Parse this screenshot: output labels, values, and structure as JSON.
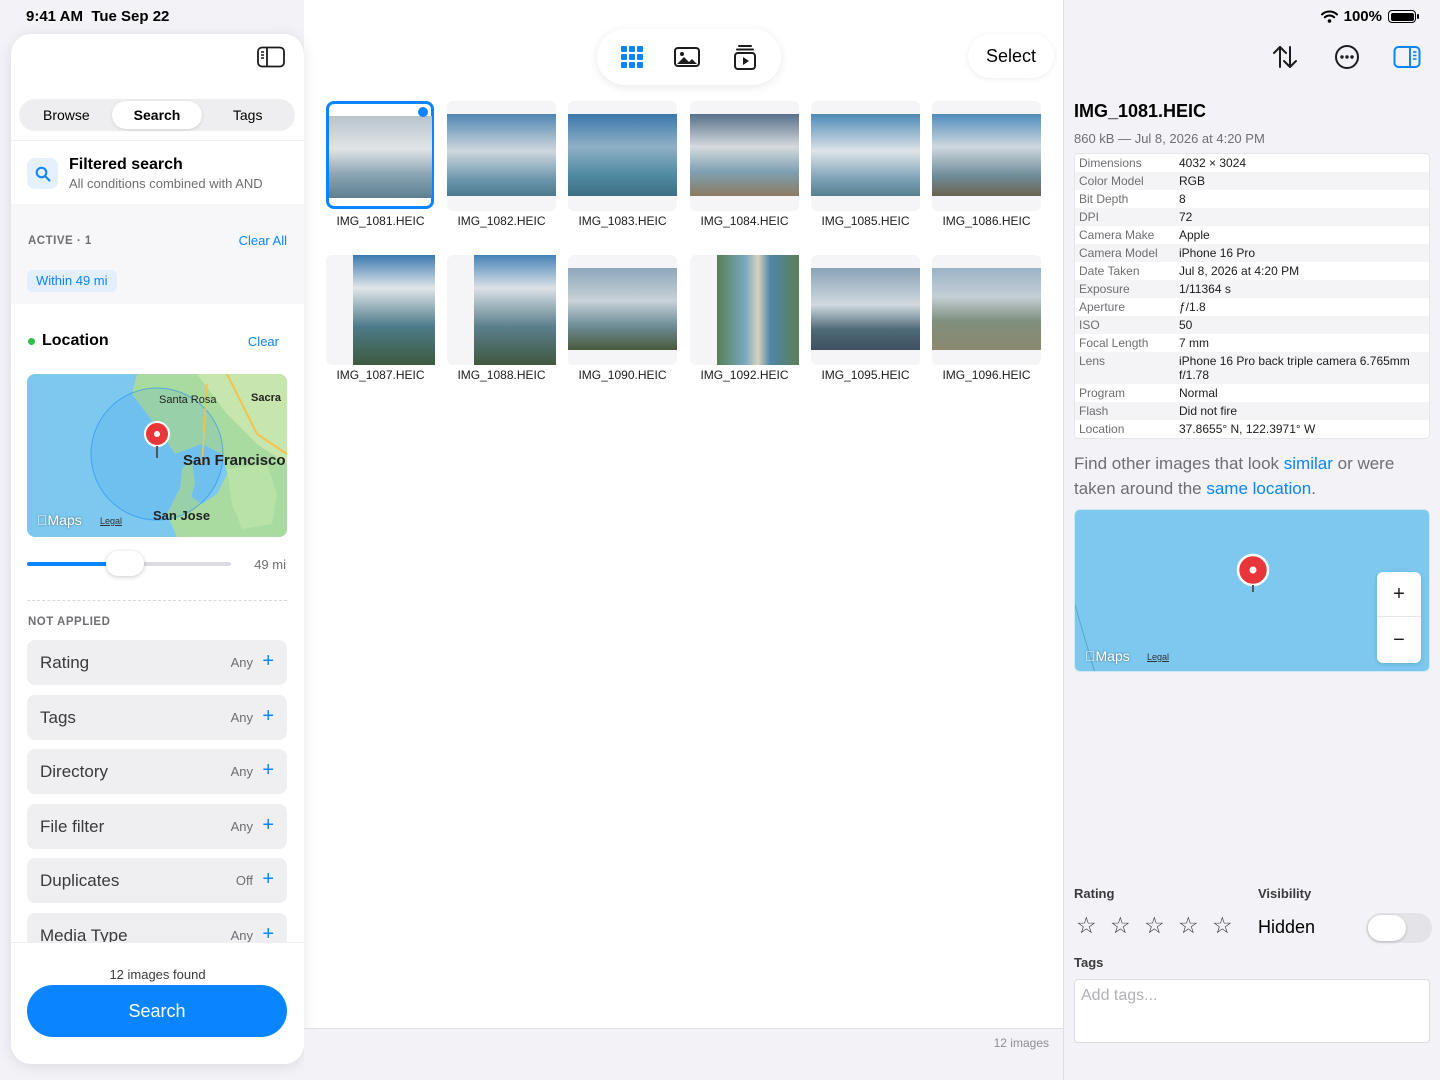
{
  "status": {
    "time": "9:41 AM",
    "date": "Tue Sep 22",
    "battery": "100%"
  },
  "sidebar": {
    "tabs": [
      {
        "label": "Browse",
        "active": false
      },
      {
        "label": "Search",
        "active": true
      },
      {
        "label": "Tags",
        "active": false
      }
    ],
    "filtered_search": {
      "title": "Filtered search",
      "subtitle": "All conditions combined with AND"
    },
    "active": {
      "label": "ACTIVE · 1",
      "clear_all": "Clear All",
      "chip": "Within 49 mi"
    },
    "location": {
      "title": "Location",
      "clear": "Clear",
      "map_labels": {
        "santa_rosa": "Santa Rosa",
        "sacramento": "Sacra",
        "san_francisco": "San Francisco",
        "san_jose": "San Jose",
        "maps": "Maps",
        "legal": "Legal"
      },
      "radius_label": "49 mi",
      "radius_fraction": 0.48
    },
    "not_applied_label": "NOT APPLIED",
    "filters": [
      {
        "name": "Rating",
        "value": "Any"
      },
      {
        "name": "Tags",
        "value": "Any"
      },
      {
        "name": "Directory",
        "value": "Any"
      },
      {
        "name": "File filter",
        "value": "Any"
      },
      {
        "name": "Duplicates",
        "value": "Off"
      },
      {
        "name": "Media Type",
        "value": "Any"
      }
    ],
    "found": "12 images found",
    "search_button": "Search"
  },
  "toolbar": {
    "select": "Select"
  },
  "images": [
    "IMG_1081.HEIC",
    "IMG_1082.HEIC",
    "IMG_1083.HEIC",
    "IMG_1084.HEIC",
    "IMG_1085.HEIC",
    "IMG_1086.HEIC",
    "IMG_1087.HEIC",
    "IMG_1088.HEIC",
    "IMG_1090.HEIC",
    "IMG_1092.HEIC",
    "IMG_1095.HEIC",
    "IMG_1096.HEIC"
  ],
  "image_count": "12 images",
  "inspector": {
    "title": "IMG_1081.HEIC",
    "subtitle": "860 kB — Jul 8, 2026 at 4:20 PM",
    "metadata": [
      {
        "k": "Dimensions",
        "v": "4032 × 3024"
      },
      {
        "k": "Color Model",
        "v": "RGB"
      },
      {
        "k": "Bit Depth",
        "v": "8"
      },
      {
        "k": "DPI",
        "v": "72"
      },
      {
        "k": "Camera Make",
        "v": "Apple"
      },
      {
        "k": "Camera Model",
        "v": "iPhone 16 Pro"
      },
      {
        "k": "Date Taken",
        "v": "Jul 8, 2026 at 4:20 PM"
      },
      {
        "k": "Exposure",
        "v": "1/11364 s"
      },
      {
        "k": "Aperture",
        "v": "ƒ/1.8"
      },
      {
        "k": "ISO",
        "v": "50"
      },
      {
        "k": "Focal Length",
        "v": "7 mm"
      },
      {
        "k": "Lens",
        "v": "iPhone 16 Pro back triple camera 6.765mm f/1.78"
      },
      {
        "k": "Program",
        "v": "Normal"
      },
      {
        "k": "Flash",
        "v": "Did not fire"
      },
      {
        "k": "Location",
        "v": "37.8655° N, 122.3971° W"
      }
    ],
    "find": {
      "prefix": "Find other images that look ",
      "similar": "similar",
      "middle": " or were taken around the ",
      "same_location": "same location",
      "suffix": "."
    },
    "map": {
      "maps": "Maps",
      "legal": "Legal",
      "zoom_in": "+",
      "zoom_out": "−"
    },
    "rating_label": "Rating",
    "visibility_label": "Visibility",
    "visibility_value": "Hidden",
    "rating_value": 0,
    "tags_label": "Tags",
    "tags_placeholder": "Add tags..."
  }
}
